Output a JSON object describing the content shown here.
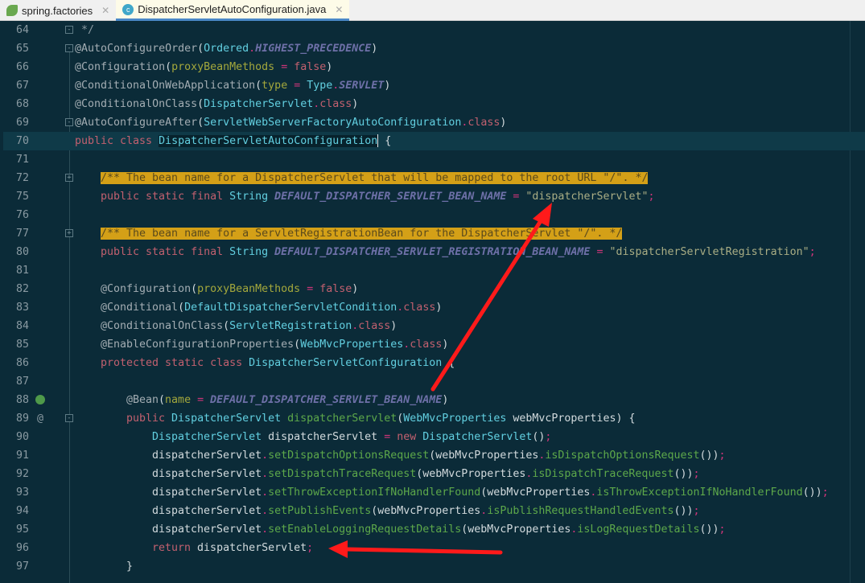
{
  "tabs": [
    {
      "label": "spring.factories",
      "icon": "spring-icon",
      "active": false
    },
    {
      "label": "DispatcherServletAutoConfiguration.java",
      "icon": "class-icon",
      "active": true
    }
  ],
  "tab_close": "✕",
  "class_icon_letter": "c",
  "code": {
    "lines": [
      {
        "num": "64",
        "indent": 0,
        "fold": "-",
        "tokens": [
          {
            "t": "g",
            "text": " */"
          }
        ]
      },
      {
        "num": "65",
        "indent": 0,
        "fold": "-",
        "tokens": [
          {
            "t": "a",
            "text": "@AutoConfigureOrder"
          },
          {
            "t": "d",
            "text": "("
          },
          {
            "t": "c",
            "text": "Ordered"
          },
          {
            "t": "o",
            "text": "."
          },
          {
            "t": "n",
            "text": "HIGHEST_PRECEDENCE"
          },
          {
            "t": "d",
            "text": ")"
          }
        ]
      },
      {
        "num": "66",
        "indent": 0,
        "tokens": [
          {
            "t": "a",
            "text": "@Configuration"
          },
          {
            "t": "d",
            "text": "("
          },
          {
            "t": "p",
            "text": "proxyBeanMethods"
          },
          {
            "t": "o",
            "text": " = "
          },
          {
            "t": "k",
            "text": "false"
          },
          {
            "t": "d",
            "text": ")"
          }
        ]
      },
      {
        "num": "67",
        "indent": 0,
        "tokens": [
          {
            "t": "a",
            "text": "@ConditionalOnWebApplication"
          },
          {
            "t": "d",
            "text": "("
          },
          {
            "t": "p",
            "text": "type"
          },
          {
            "t": "o",
            "text": " = "
          },
          {
            "t": "c",
            "text": "Type"
          },
          {
            "t": "o",
            "text": "."
          },
          {
            "t": "n",
            "text": "SERVLET"
          },
          {
            "t": "d",
            "text": ")"
          }
        ]
      },
      {
        "num": "68",
        "indent": 0,
        "tokens": [
          {
            "t": "a",
            "text": "@ConditionalOnClass"
          },
          {
            "t": "d",
            "text": "("
          },
          {
            "t": "c",
            "text": "DispatcherServlet"
          },
          {
            "t": "o",
            "text": "."
          },
          {
            "t": "k",
            "text": "class"
          },
          {
            "t": "d",
            "text": ")"
          }
        ]
      },
      {
        "num": "69",
        "indent": 0,
        "fold": "-",
        "tokens": [
          {
            "t": "a",
            "text": "@AutoConfigureAfter"
          },
          {
            "t": "d",
            "text": "("
          },
          {
            "t": "c",
            "text": "ServletWebServerFactoryAutoConfiguration"
          },
          {
            "t": "o",
            "text": "."
          },
          {
            "t": "k",
            "text": "class"
          },
          {
            "t": "d",
            "text": ")"
          }
        ]
      },
      {
        "num": "70",
        "indent": 0,
        "current": true,
        "tokens": [
          {
            "t": "k",
            "text": "public class "
          },
          {
            "t": "sel",
            "text": "DispatcherServletAutoConfiguration"
          },
          {
            "t": "caret",
            "text": ""
          },
          {
            "t": "d",
            "text": " {"
          }
        ]
      },
      {
        "num": "71",
        "indent": 0,
        "tokens": []
      },
      {
        "num": "72",
        "indent": 4,
        "fold": "+",
        "tokens": [
          {
            "t": "cm",
            "text": "/** The bean name for a DispatcherServlet that will be mapped to the root URL \"/\". */"
          }
        ]
      },
      {
        "num": "75",
        "indent": 4,
        "tokens": [
          {
            "t": "k",
            "text": "public static final "
          },
          {
            "t": "c",
            "text": "String"
          },
          {
            "t": "d",
            "text": " "
          },
          {
            "t": "n",
            "text": "DEFAULT_DISPATCHER_SERVLET_BEAN_NAME"
          },
          {
            "t": "o",
            "text": " = "
          },
          {
            "t": "s",
            "text": "\"dispatcherServlet\""
          },
          {
            "t": "o",
            "text": ";"
          }
        ]
      },
      {
        "num": "76",
        "indent": 0,
        "tokens": []
      },
      {
        "num": "77",
        "indent": 4,
        "fold": "+",
        "tokens": [
          {
            "t": "cm",
            "text": "/** The bean name for a ServletRegistrationBean for the DispatcherServlet \"/\". */"
          }
        ]
      },
      {
        "num": "80",
        "indent": 4,
        "tokens": [
          {
            "t": "k",
            "text": "public static final "
          },
          {
            "t": "c",
            "text": "String"
          },
          {
            "t": "d",
            "text": " "
          },
          {
            "t": "n",
            "text": "DEFAULT_DISPATCHER_SERVLET_REGISTRATION_BEAN_NAME"
          },
          {
            "t": "o",
            "text": " = "
          },
          {
            "t": "s",
            "text": "\"dispatcherServletRegistration\""
          },
          {
            "t": "o",
            "text": ";"
          }
        ]
      },
      {
        "num": "81",
        "indent": 0,
        "tokens": []
      },
      {
        "num": "82",
        "indent": 4,
        "tokens": [
          {
            "t": "a",
            "text": "@Configuration"
          },
          {
            "t": "d",
            "text": "("
          },
          {
            "t": "p",
            "text": "proxyBeanMethods"
          },
          {
            "t": "o",
            "text": " = "
          },
          {
            "t": "k",
            "text": "false"
          },
          {
            "t": "d",
            "text": ")"
          }
        ]
      },
      {
        "num": "83",
        "indent": 4,
        "tokens": [
          {
            "t": "a",
            "text": "@Conditional"
          },
          {
            "t": "d",
            "text": "("
          },
          {
            "t": "c",
            "text": "DefaultDispatcherServletCondition"
          },
          {
            "t": "o",
            "text": "."
          },
          {
            "t": "k",
            "text": "class"
          },
          {
            "t": "d",
            "text": ")"
          }
        ]
      },
      {
        "num": "84",
        "indent": 4,
        "tokens": [
          {
            "t": "a",
            "text": "@ConditionalOnClass"
          },
          {
            "t": "d",
            "text": "("
          },
          {
            "t": "c",
            "text": "ServletRegistration"
          },
          {
            "t": "o",
            "text": "."
          },
          {
            "t": "k",
            "text": "class"
          },
          {
            "t": "d",
            "text": ")"
          }
        ]
      },
      {
        "num": "85",
        "indent": 4,
        "tokens": [
          {
            "t": "a",
            "text": "@EnableConfigurationProperties"
          },
          {
            "t": "d",
            "text": "("
          },
          {
            "t": "c",
            "text": "WebMvcProperties"
          },
          {
            "t": "o",
            "text": "."
          },
          {
            "t": "k",
            "text": "class"
          },
          {
            "t": "d",
            "text": ")"
          }
        ]
      },
      {
        "num": "86",
        "indent": 4,
        "tokens": [
          {
            "t": "k",
            "text": "protected static class "
          },
          {
            "t": "c",
            "text": "DispatcherServletConfiguration"
          },
          {
            "t": "d",
            "text": " {"
          }
        ]
      },
      {
        "num": "87",
        "indent": 0,
        "tokens": []
      },
      {
        "num": "88",
        "indent": 8,
        "gutter": "bean",
        "tokens": [
          {
            "t": "a",
            "text": "@Bean"
          },
          {
            "t": "d",
            "text": "("
          },
          {
            "t": "p",
            "text": "name"
          },
          {
            "t": "o",
            "text": " = "
          },
          {
            "t": "n",
            "text": "DEFAULT_DISPATCHER_SERVLET_BEAN_NAME"
          },
          {
            "t": "d",
            "text": ")"
          }
        ]
      },
      {
        "num": "89",
        "indent": 8,
        "gutter": "@",
        "fold": "-",
        "tokens": [
          {
            "t": "k",
            "text": "public "
          },
          {
            "t": "c",
            "text": "DispatcherServlet"
          },
          {
            "t": "d",
            "text": " "
          },
          {
            "t": "m",
            "text": "dispatcherServlet"
          },
          {
            "t": "d",
            "text": "("
          },
          {
            "t": "c",
            "text": "WebMvcProperties"
          },
          {
            "t": "d",
            "text": " webMvcProperties) {"
          }
        ]
      },
      {
        "num": "90",
        "indent": 12,
        "tokens": [
          {
            "t": "c",
            "text": "DispatcherServlet"
          },
          {
            "t": "d",
            "text": " dispatcherServlet"
          },
          {
            "t": "o",
            "text": " = "
          },
          {
            "t": "k",
            "text": "new "
          },
          {
            "t": "c",
            "text": "DispatcherServlet"
          },
          {
            "t": "d",
            "text": "()"
          },
          {
            "t": "o",
            "text": ";"
          }
        ]
      },
      {
        "num": "91",
        "indent": 12,
        "tokens": [
          {
            "t": "d",
            "text": "dispatcherServlet"
          },
          {
            "t": "o",
            "text": "."
          },
          {
            "t": "m",
            "text": "setDispatchOptionsRequest"
          },
          {
            "t": "d",
            "text": "(webMvcProperties"
          },
          {
            "t": "o",
            "text": "."
          },
          {
            "t": "m",
            "text": "isDispatchOptionsRequest"
          },
          {
            "t": "d",
            "text": "())"
          },
          {
            "t": "o",
            "text": ";"
          }
        ]
      },
      {
        "num": "92",
        "indent": 12,
        "tokens": [
          {
            "t": "d",
            "text": "dispatcherServlet"
          },
          {
            "t": "o",
            "text": "."
          },
          {
            "t": "m",
            "text": "setDispatchTraceRequest"
          },
          {
            "t": "d",
            "text": "(webMvcProperties"
          },
          {
            "t": "o",
            "text": "."
          },
          {
            "t": "m",
            "text": "isDispatchTraceRequest"
          },
          {
            "t": "d",
            "text": "())"
          },
          {
            "t": "o",
            "text": ";"
          }
        ]
      },
      {
        "num": "93",
        "indent": 12,
        "tokens": [
          {
            "t": "d",
            "text": "dispatcherServlet"
          },
          {
            "t": "o",
            "text": "."
          },
          {
            "t": "m",
            "text": "setThrowExceptionIfNoHandlerFound"
          },
          {
            "t": "d",
            "text": "(webMvcProperties"
          },
          {
            "t": "o",
            "text": "."
          },
          {
            "t": "m",
            "text": "isThrowExceptionIfNoHandlerFound"
          },
          {
            "t": "d",
            "text": "())"
          },
          {
            "t": "o",
            "text": ";"
          }
        ]
      },
      {
        "num": "94",
        "indent": 12,
        "tokens": [
          {
            "t": "d",
            "text": "dispatcherServlet"
          },
          {
            "t": "o",
            "text": "."
          },
          {
            "t": "m",
            "text": "setPublishEvents"
          },
          {
            "t": "d",
            "text": "(webMvcProperties"
          },
          {
            "t": "o",
            "text": "."
          },
          {
            "t": "m",
            "text": "isPublishRequestHandledEvents"
          },
          {
            "t": "d",
            "text": "())"
          },
          {
            "t": "o",
            "text": ";"
          }
        ]
      },
      {
        "num": "95",
        "indent": 12,
        "tokens": [
          {
            "t": "d",
            "text": "dispatcherServlet"
          },
          {
            "t": "o",
            "text": "."
          },
          {
            "t": "m",
            "text": "setEnableLoggingRequestDetails"
          },
          {
            "t": "d",
            "text": "(webMvcProperties"
          },
          {
            "t": "o",
            "text": "."
          },
          {
            "t": "m",
            "text": "isLogRequestDetails"
          },
          {
            "t": "d",
            "text": "())"
          },
          {
            "t": "o",
            "text": ";"
          }
        ]
      },
      {
        "num": "96",
        "indent": 12,
        "tokens": [
          {
            "t": "k",
            "text": "return "
          },
          {
            "t": "d",
            "text": "dispatcherServlet"
          },
          {
            "t": "o",
            "text": ";"
          }
        ]
      },
      {
        "num": "97",
        "indent": 8,
        "tokens": [
          {
            "t": "d",
            "text": "}"
          }
        ]
      }
    ]
  },
  "annotation_color": "#ff1a1a"
}
